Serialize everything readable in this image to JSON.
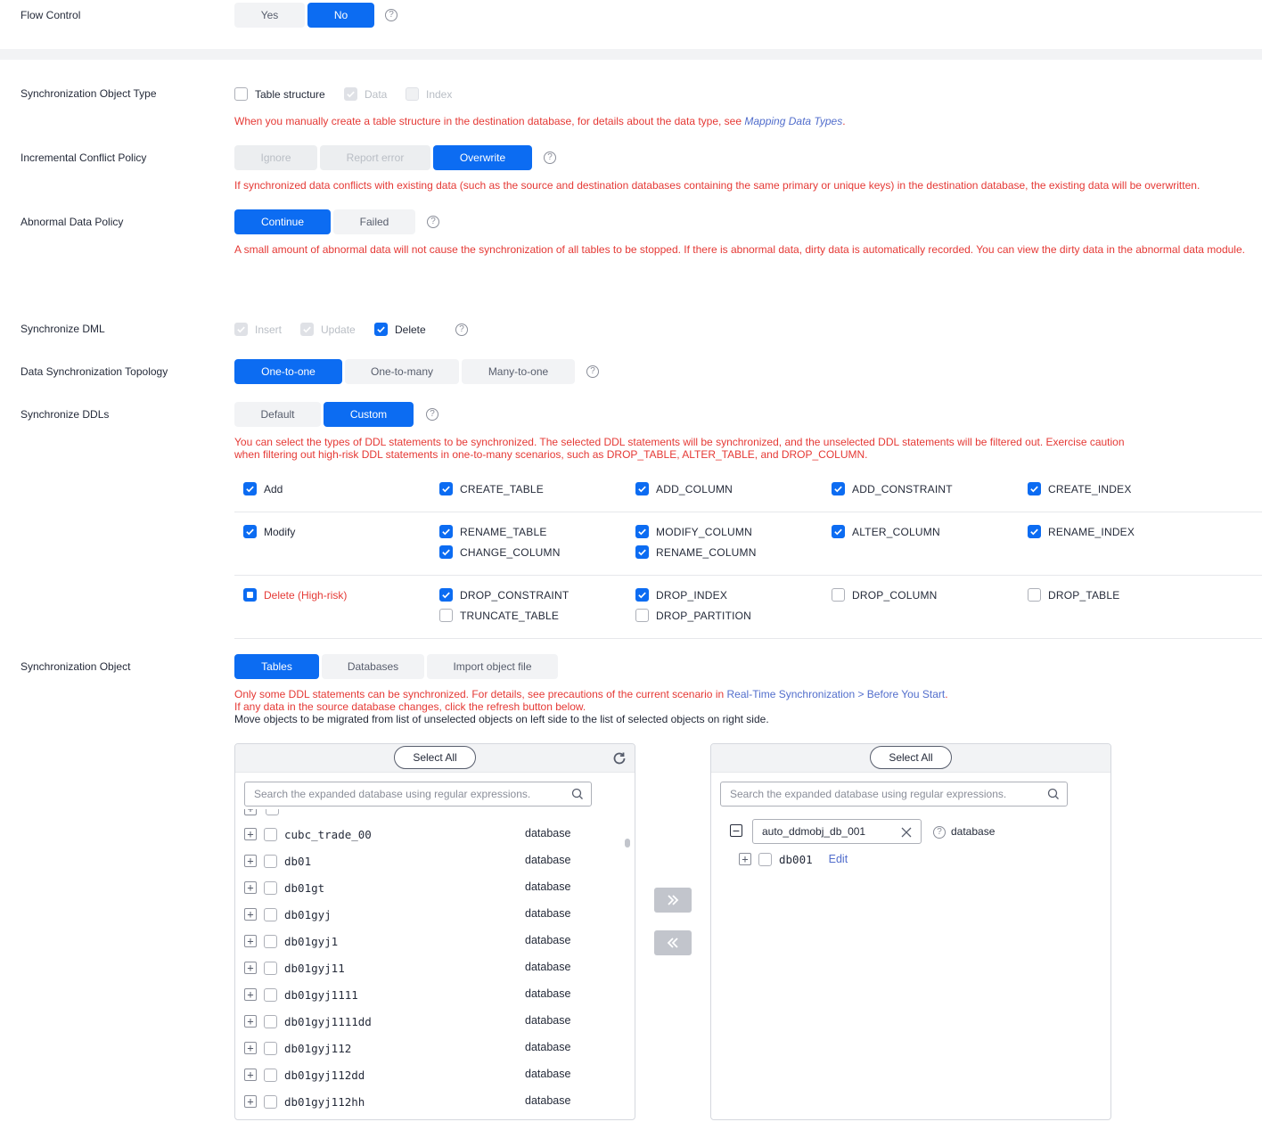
{
  "flow_control": {
    "label": "Flow Control",
    "options": [
      "Yes",
      "No"
    ],
    "selected": "No"
  },
  "sync_object_type": {
    "label": "Synchronization Object Type",
    "options": [
      {
        "label": "Table structure",
        "state": "unchecked"
      },
      {
        "label": "Data",
        "state": "checked-disabled"
      },
      {
        "label": "Index",
        "state": "unchecked-disabled"
      }
    ],
    "note": "When you manually create a table structure in the destination database, for details about the data type, see",
    "note_link": "Mapping Data Types",
    "note_end": "."
  },
  "incremental_conflict": {
    "label": "Incremental Conflict Policy",
    "options": [
      "Ignore",
      "Report error",
      "Overwrite"
    ],
    "selected": "Overwrite",
    "note": "If synchronized data conflicts with existing data (such as the source and destination databases containing the same primary or unique keys) in the destination database, the existing data will be overwritten."
  },
  "abnormal_data": {
    "label": "Abnormal Data Policy",
    "options": [
      "Continue",
      "Failed"
    ],
    "selected": "Continue",
    "note": "A small amount of abnormal data will not cause the synchronization of all tables to be stopped. If there is abnormal data, dirty data is automatically recorded. You can view the dirty data in the abnormal data module."
  },
  "sync_dml": {
    "label": "Synchronize DML",
    "options": [
      {
        "label": "Insert",
        "state": "checked-disabled"
      },
      {
        "label": "Update",
        "state": "checked-disabled"
      },
      {
        "label": "Delete",
        "state": "checked"
      }
    ]
  },
  "topology": {
    "label": "Data Synchronization Topology",
    "options": [
      "One-to-one",
      "One-to-many",
      "Many-to-one"
    ],
    "selected": "One-to-one"
  },
  "sync_ddls": {
    "label": "Synchronize DDLs",
    "options": [
      "Default",
      "Custom"
    ],
    "selected": "Custom",
    "note_line1": "You can select the types of DDL statements to be synchronized. The selected DDL statements will be synchronized, and the unselected DDL statements will be filtered out. Exercise caution",
    "note_line2": "when filtering out high-risk DDL statements in one-to-many scenarios, such as DROP_TABLE, ALTER_TABLE, and DROP_COLUMN.",
    "groups": {
      "add": {
        "label": "Add",
        "state": "checked",
        "items": [
          {
            "label": "CREATE_TABLE",
            "state": "checked"
          },
          {
            "label": "ADD_COLUMN",
            "state": "checked"
          },
          {
            "label": "ADD_CONSTRAINT",
            "state": "checked"
          },
          {
            "label": "CREATE_INDEX",
            "state": "checked"
          }
        ]
      },
      "modify": {
        "label": "Modify",
        "state": "checked",
        "items": [
          {
            "label": "RENAME_TABLE",
            "state": "checked"
          },
          {
            "label": "MODIFY_COLUMN",
            "state": "checked"
          },
          {
            "label": "ALTER_COLUMN",
            "state": "checked"
          },
          {
            "label": "RENAME_INDEX",
            "state": "checked"
          },
          {
            "label": "CHANGE_COLUMN",
            "state": "checked"
          },
          {
            "label": "RENAME_COLUMN",
            "state": "checked"
          }
        ]
      },
      "delete": {
        "label": "Delete (High-risk)",
        "state": "partial",
        "items": [
          {
            "label": "DROP_CONSTRAINT",
            "state": "checked"
          },
          {
            "label": "DROP_INDEX",
            "state": "checked"
          },
          {
            "label": "DROP_COLUMN",
            "state": "unchecked"
          },
          {
            "label": "DROP_TABLE",
            "state": "unchecked"
          },
          {
            "label": "TRUNCATE_TABLE",
            "state": "unchecked"
          },
          {
            "label": "DROP_PARTITION",
            "state": "unchecked"
          }
        ]
      }
    }
  },
  "sync_object": {
    "label": "Synchronization Object",
    "tabs": [
      "Tables",
      "Databases",
      "Import object file"
    ],
    "selected": "Tables",
    "note1": "Only some DDL statements can be synchronized. For details, see precautions of the current scenario in",
    "note1_link": "Real-Time Synchronization > Before You Start",
    "note1_end": ".",
    "note2": "If any data in the source database changes, click the refresh button below.",
    "note3": "Move objects to be migrated from list of unselected objects on left side to the list of selected objects on right side.",
    "left_panel": {
      "select_all": "Select All",
      "search_placeholder": "Search the expanded database using regular expressions.",
      "rows": [
        {
          "name": "cubc_trade_00",
          "type": "database"
        },
        {
          "name": "db01",
          "type": "database"
        },
        {
          "name": "db01gt",
          "type": "database"
        },
        {
          "name": "db01gyj",
          "type": "database"
        },
        {
          "name": "db01gyj1",
          "type": "database"
        },
        {
          "name": "db01gyj11",
          "type": "database"
        },
        {
          "name": "db01gyj1111",
          "type": "database"
        },
        {
          "name": "db01gyj1111dd",
          "type": "database"
        },
        {
          "name": "db01gyj112",
          "type": "database"
        },
        {
          "name": "db01gyj112dd",
          "type": "database"
        },
        {
          "name": "db01gyj112hh",
          "type": "database"
        }
      ]
    },
    "right_panel": {
      "select_all": "Select All",
      "search_placeholder": "Search the expanded database using regular expressions.",
      "root": {
        "name": "auto_ddmobj_db_001",
        "type": "database"
      },
      "child": {
        "name": "db001",
        "action": "Edit"
      }
    }
  },
  "colors": {
    "primary": "#0c6cf2",
    "danger": "#e53935",
    "link": "#526ecc"
  }
}
